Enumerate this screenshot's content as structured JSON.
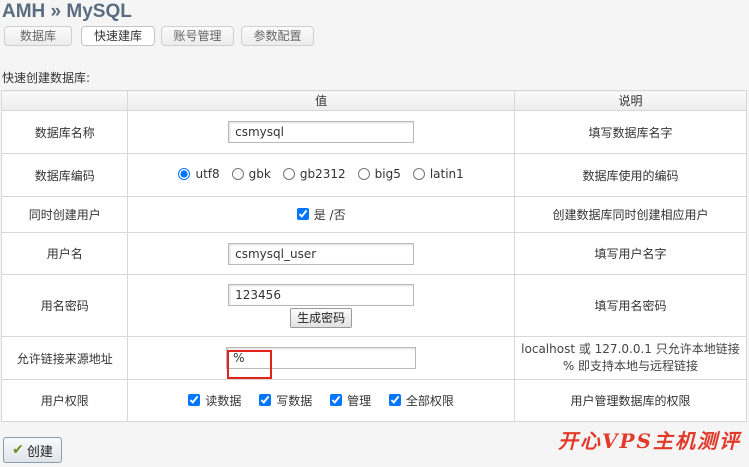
{
  "header": {
    "title": "AMH » MySQL"
  },
  "tabs": [
    {
      "label": "数据库",
      "active": false
    },
    {
      "label": "快速建库",
      "active": true
    },
    {
      "label": "账号管理",
      "active": false
    },
    {
      "label": "参数配置",
      "active": false
    }
  ],
  "section_label": "快速创建数据库:",
  "table": {
    "headers": [
      "",
      "值",
      "说明"
    ],
    "rows": {
      "db_name": {
        "label": "数据库名称",
        "value": "csmysql",
        "desc": "填写数据库名字"
      },
      "db_encoding": {
        "label": "数据库编码",
        "options": [
          "utf8",
          "gbk",
          "gb2312",
          "big5",
          "latin1"
        ],
        "selected": "utf8",
        "desc": "数据库使用的编码"
      },
      "create_user": {
        "label": "同时创建用户",
        "yes": "是",
        "no": "/否",
        "checked": true,
        "desc": "创建数据库同时创建相应用户"
      },
      "username": {
        "label": "用户名",
        "value": "csmysql_user",
        "desc": "填写用户名字"
      },
      "password": {
        "label": "用名密码",
        "value": "123456",
        "gen_button": "生成密码",
        "desc": "填写用名密码"
      },
      "allowed_host": {
        "label": "允许链接来源地址",
        "value": "%",
        "desc_line1": "localhost 或  127.0.0.1 只允许本地链接",
        "desc_line2": "% 即支持本地与远程链接"
      },
      "privileges": {
        "label": "用户权限",
        "options": [
          "读数据",
          "写数据",
          "管理",
          "全部权限"
        ],
        "checked": [
          true,
          true,
          true,
          true
        ],
        "desc": "用户管理数据库的权限"
      }
    }
  },
  "create_button": "创建",
  "watermark": "开心VPS主机测评"
}
